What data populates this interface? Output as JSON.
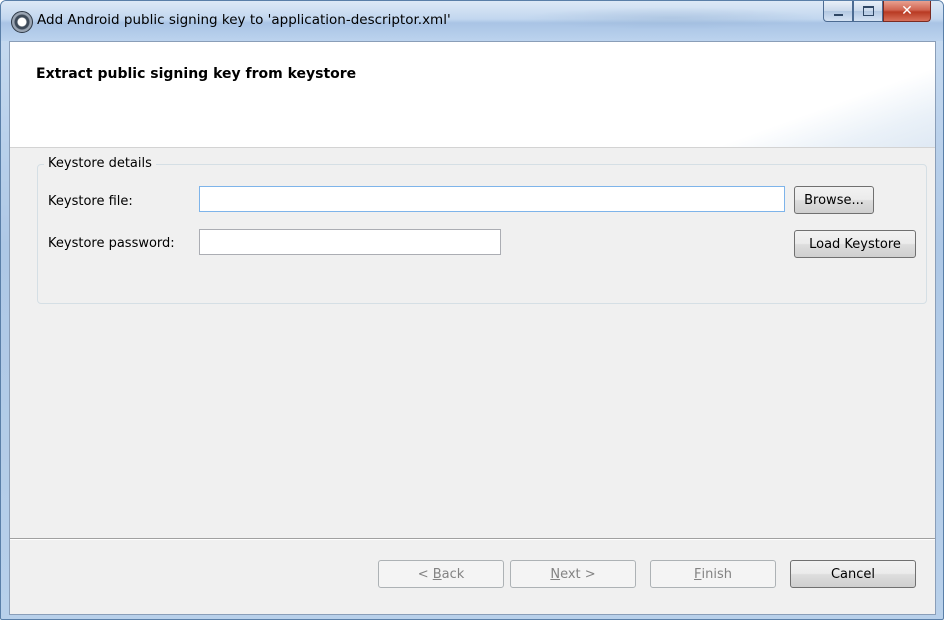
{
  "window": {
    "title": "Add Android public signing key to 'application-descriptor.xml'",
    "icon": "eclipse-app-icon"
  },
  "banner": {
    "title": "Extract public signing key from keystore"
  },
  "keystore_group": {
    "label": "Keystore details",
    "file_label": "Keystore file:",
    "file_value": "",
    "password_label": "Keystore password:",
    "password_value": "",
    "browse_label": "Browse...",
    "load_label": "Load Keystore"
  },
  "footer": {
    "back": {
      "prefix": "< ",
      "mnemonic": "B",
      "rest": "ack",
      "enabled": false
    },
    "next": {
      "mnemonic": "N",
      "rest": "ext >",
      "enabled": false
    },
    "finish": {
      "mnemonic": "F",
      "rest": "inish",
      "enabled": false
    },
    "cancel": {
      "label": "Cancel",
      "enabled": true
    }
  }
}
